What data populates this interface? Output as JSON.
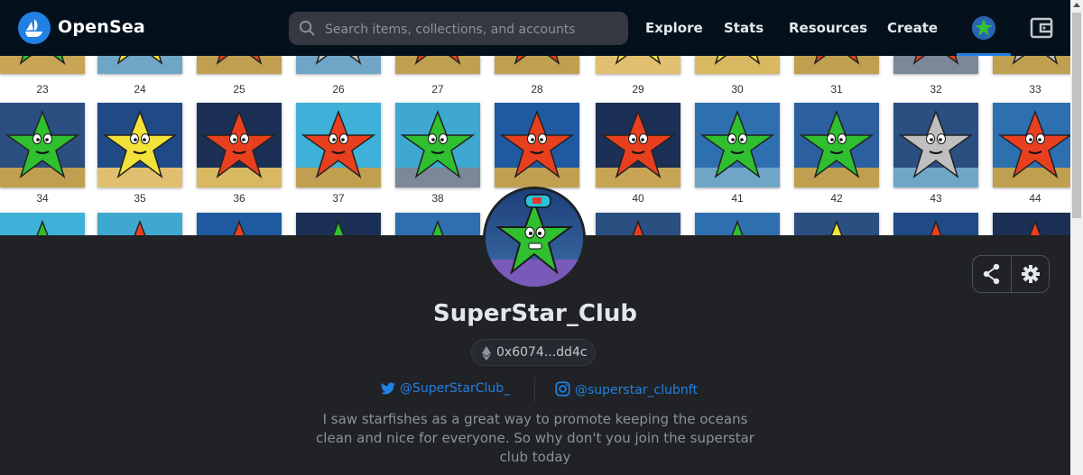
{
  "header": {
    "brand": "OpenSea",
    "search_placeholder": "Search items, collections, and accounts",
    "nav": [
      "Explore",
      "Stats",
      "Resources",
      "Create"
    ]
  },
  "banner": {
    "rows": [
      {
        "labels": [
          "23",
          "24",
          "25",
          "26",
          "27",
          "28",
          "29",
          "30",
          "31",
          "32",
          "33"
        ]
      },
      {
        "labels": [
          "34",
          "35",
          "36",
          "37",
          "38",
          "",
          "40",
          "41",
          "42",
          "43",
          "44"
        ]
      }
    ]
  },
  "profile": {
    "name": "SuperStar_Club",
    "address": "0x6074...dd4c",
    "twitter": "@SuperStarClub_",
    "instagram": "@superstar_clubnft",
    "bio": "I saw starfishes as a great way to promote keeping the oceans clean and nice for everyone. So why don't you join the superstar club today"
  },
  "colors": {
    "nav_bg": "#04111d",
    "accent": "#2081e2",
    "page_bg": "#202225"
  },
  "icons": [
    "opensea-logo-icon",
    "search-icon",
    "wallet-icon",
    "share-icon",
    "gear-icon",
    "ethereum-icon",
    "twitter-icon",
    "instagram-icon"
  ]
}
